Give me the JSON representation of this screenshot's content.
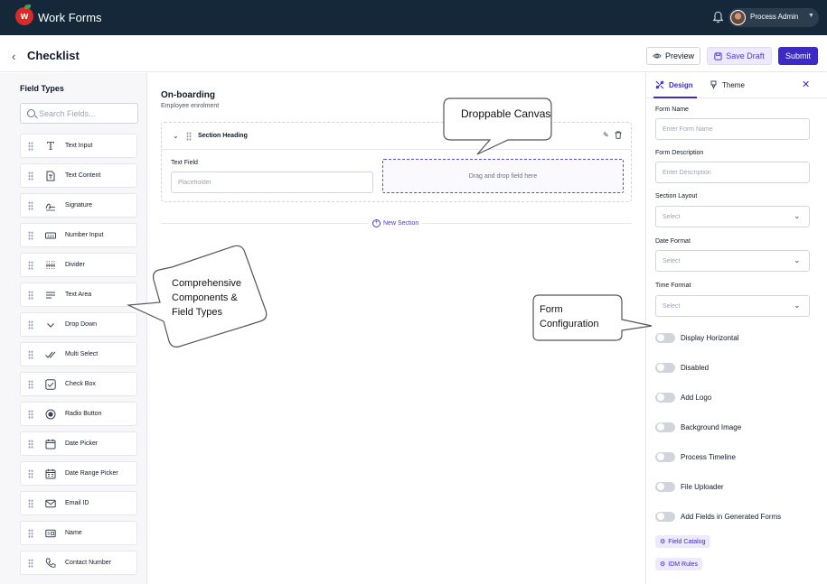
{
  "app": {
    "title": "Work Forms",
    "logo_letter": "w"
  },
  "user": {
    "name": "Process Admin"
  },
  "header": {
    "title": "Checklist",
    "preview_label": "Preview",
    "save_draft_label": "Save Draft",
    "submit_label": "Submit"
  },
  "left": {
    "title": "Field Types",
    "search_placeholder": "Search Fields...",
    "items": [
      {
        "label": "Text Input",
        "icon": "text-icon"
      },
      {
        "label": "Text Content",
        "icon": "text-content-icon"
      },
      {
        "label": "Signature",
        "icon": "signature-icon"
      },
      {
        "label": "Number Input",
        "icon": "number-icon"
      },
      {
        "label": "Divider",
        "icon": "divider-icon"
      },
      {
        "label": "Text Area",
        "icon": "text-area-icon"
      },
      {
        "label": "Drop Down",
        "icon": "chevron-down-icon"
      },
      {
        "label": "Multi Select",
        "icon": "multi-check-icon"
      },
      {
        "label": "Check Box",
        "icon": "checkbox-icon"
      },
      {
        "label": "Radio Button",
        "icon": "radio-icon"
      },
      {
        "label": "Date Picker",
        "icon": "calendar-icon"
      },
      {
        "label": "Date Range Picker",
        "icon": "calendar-range-icon"
      },
      {
        "label": "Email ID",
        "icon": "mail-icon"
      },
      {
        "label": "Name",
        "icon": "id-card-icon"
      },
      {
        "label": "Contact Number",
        "icon": "phone-icon"
      }
    ]
  },
  "canvas": {
    "form_title": "On-boarding",
    "form_subtitle": "Employee enrolment",
    "section_heading": "Section Heading",
    "text_field_label": "Text Field",
    "text_field_placeholder": "Placeholder",
    "drop_text": "Drag and drop field here",
    "new_section_label": "New Section"
  },
  "right": {
    "tab_design": "Design",
    "tab_theme": "Theme",
    "form_name_label": "Form Name",
    "form_name_placeholder": "Enter Form Name",
    "form_desc_label": "Form Description",
    "form_desc_placeholder": "Enter Description",
    "section_layout_label": "Section Layout",
    "date_format_label": "Date Format",
    "time_format_label": "Time Format",
    "select_placeholder": "Select",
    "toggles": [
      "Display Horizontal",
      "Disabled",
      "Add Logo",
      "Background Image",
      "Process Timeline",
      "File Uploader",
      "Add Fields in Generated Forms"
    ],
    "chip_field_catalog": "Field Catalog",
    "chip_idm_rules": "IDM Rules"
  },
  "callouts": {
    "canvas": "Droppable Canvas",
    "components_line1": "Comprehensive",
    "components_line2": "Components &",
    "components_line3": "Field Types",
    "config_line1": "Form",
    "config_line2": "Configuration"
  },
  "colors": {
    "topbar": "#14283a",
    "accent": "#3b2bc4",
    "logo": "#d62b27"
  }
}
